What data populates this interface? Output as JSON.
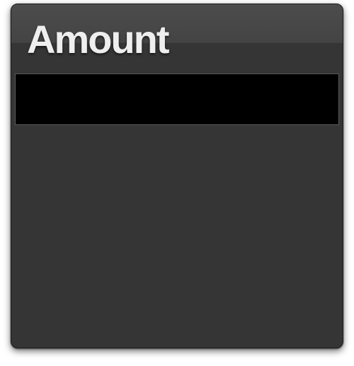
{
  "panel": {
    "title": "Amount"
  },
  "amount_input": {
    "value": "",
    "placeholder": ""
  },
  "colors": {
    "panel_background": "#353535",
    "header_gloss": "#4c4c4c",
    "input_background": "#000000",
    "title_text": "#eeeeee"
  }
}
